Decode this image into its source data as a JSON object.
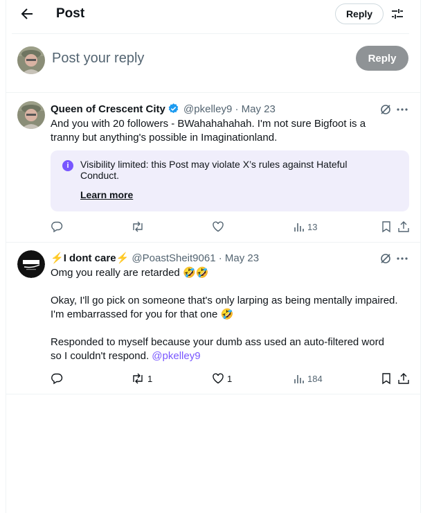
{
  "header": {
    "title": "Post",
    "reply_label": "Reply"
  },
  "compose": {
    "placeholder": "Post your reply",
    "reply_label": "Reply"
  },
  "tweets": [
    {
      "name": "Queen of Crescent City",
      "handle": "@pkelley9",
      "date": "· May 23",
      "lines": [
        "And you with 20 followers - BWahahahahah.  I'm not sure Bigfoot is a",
        "tranny but anything's possible in Imaginationland."
      ],
      "notice": {
        "text": "Visibility limited: this Post may violate X’s rules against Hateful Conduct.",
        "link": "Learn more"
      },
      "views": "13"
    },
    {
      "name_prefix": "⚡",
      "name": "I dont care",
      "name_suffix": "⚡",
      "handle": "@PoastSheit9061",
      "date": "· May 23",
      "line1": "Omg you really are retarded",
      "line1_emoji": "🤣🤣",
      "para2_line1": "Okay, I'll go pick on someone that's only larping as being mentally impaired.",
      "para2_line2": "I'm embarrassed for you for that one",
      "para2_emoji": "🤣",
      "para3_line1": "Responded to myself because your dumb ass used an auto-filtered word",
      "para3_line2": "so I couldn't respond.",
      "mention": "@pkelley9",
      "retweets": "1",
      "likes": "1",
      "views": "184"
    }
  ],
  "colors": {
    "accent": "#1d9bf0",
    "purple": "#7856ff",
    "muted": "#536471",
    "notice_bg": "#f0eefb"
  }
}
